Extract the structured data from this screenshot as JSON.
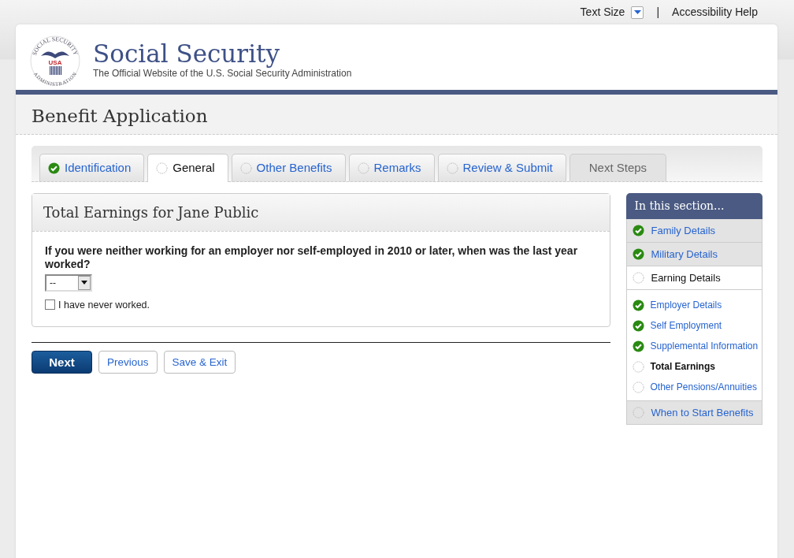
{
  "utility_bar": {
    "text_size_label": "Text Size",
    "separator": "|",
    "accessibility_link": "Accessibility Help"
  },
  "header": {
    "seal_top": "SOCIAL SECURITY",
    "seal_bottom": "ADMINISTRATION",
    "seal_center": "USA",
    "title": "Social Security",
    "subtitle": "The Official Website of the U.S. Social Security Administration"
  },
  "page_title": "Benefit Application",
  "tabs": [
    {
      "label": "Identification",
      "completed": true,
      "selected": false,
      "disabled": false
    },
    {
      "label": "General",
      "completed": false,
      "selected": true,
      "disabled": false
    },
    {
      "label": "Other Benefits",
      "completed": false,
      "selected": false,
      "disabled": false
    },
    {
      "label": "Remarks",
      "completed": false,
      "selected": false,
      "disabled": false
    },
    {
      "label": "Review & Submit",
      "completed": false,
      "selected": false,
      "disabled": false
    },
    {
      "label": "Next Steps",
      "selected": false,
      "disabled": true
    }
  ],
  "form": {
    "title": "Total Earnings for Jane Public",
    "question": "If you were neither working for an employer nor self-employed in 2010 or later, when was the last year worked?",
    "year_select": {
      "value": "--"
    },
    "never_worked": {
      "label": "I have never worked.",
      "checked": false
    }
  },
  "buttons": [
    {
      "label": "Next",
      "kind": "primary"
    },
    {
      "label": "Previous",
      "kind": "secondary"
    },
    {
      "label": "Save & Exit",
      "kind": "secondary"
    }
  ],
  "sidebar": {
    "title": "In this section...",
    "items": [
      {
        "label": "Family Details",
        "completed": true,
        "selected": false
      },
      {
        "label": "Military Details",
        "completed": true,
        "selected": false
      },
      {
        "label": "Earning Details",
        "completed": false,
        "selected": true,
        "children": [
          {
            "label": "Employer Details",
            "completed": true,
            "selected": false
          },
          {
            "label": "Self Employment",
            "completed": true,
            "selected": false
          },
          {
            "label": "Supplemental Information",
            "completed": true,
            "selected": false
          },
          {
            "label": "Total Earnings",
            "completed": false,
            "selected": true
          },
          {
            "label": "Other Pensions/Annuities",
            "completed": false,
            "selected": false
          }
        ]
      },
      {
        "label": "When to Start Benefits",
        "completed": false,
        "selected": false
      }
    ]
  }
}
